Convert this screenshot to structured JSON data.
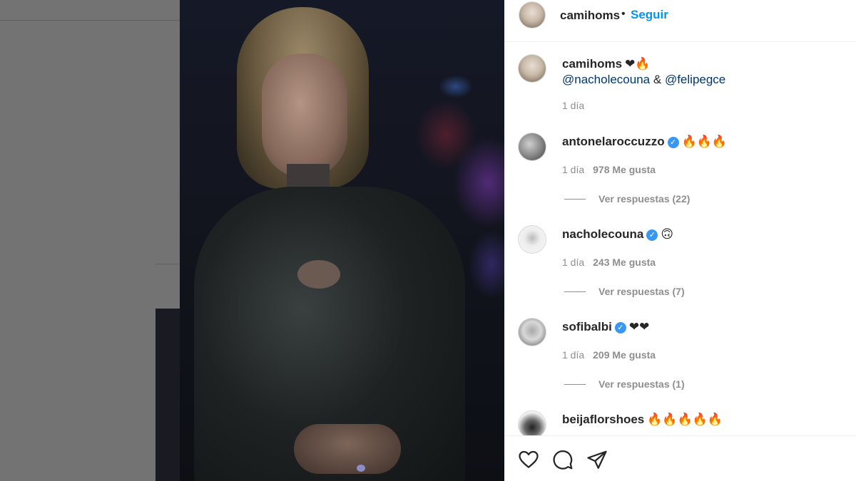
{
  "post": {
    "author": "camihoms",
    "separator": "•",
    "follow_label": "Seguir",
    "caption": {
      "username": "camihoms",
      "emoji": "❤🔥",
      "mention_1": "@nacholecouna",
      "amp": "&",
      "mention_2": "@felipegce",
      "time": "1 día"
    }
  },
  "comments": [
    {
      "username": "antonelaroccuzzo",
      "verified": true,
      "text": "🔥🔥🔥",
      "time": "1 día",
      "likes": "978 Me gusta",
      "replies": "Ver respuestas (22)"
    },
    {
      "username": "nacholecouna",
      "verified": true,
      "text": "🙃",
      "time": "1 día",
      "likes": "243 Me gusta",
      "replies": "Ver respuestas (7)"
    },
    {
      "username": "sofibalbi",
      "verified": true,
      "text": "❤❤",
      "time": "1 día",
      "likes": "209 Me gusta",
      "replies": "Ver respuestas (1)"
    },
    {
      "username": "beijaflorshoes",
      "verified": false,
      "text": "🔥🔥🔥🔥🔥",
      "time": "",
      "likes": "",
      "replies": ""
    }
  ],
  "actions": {
    "like_icon": "heart-outline",
    "comment_icon": "speech-bubble",
    "share_icon": "paper-plane"
  },
  "colors": {
    "accent": "#0095f6",
    "mention": "#00376b",
    "muted": "#8e8e8e",
    "verified": "#3897f0"
  }
}
